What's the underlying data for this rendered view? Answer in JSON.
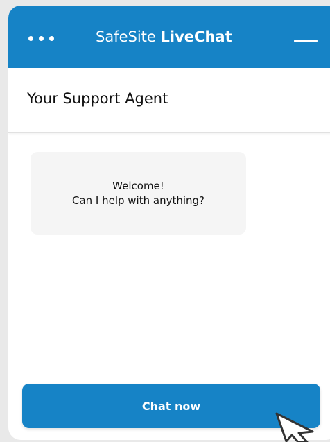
{
  "header": {
    "title_regular": "SafeSite",
    "title_bold": "LiveChat",
    "menu_icon": "more-dots-icon",
    "minimize_icon": "minimize-icon"
  },
  "agent": {
    "title": "Your Support Agent"
  },
  "conversation": {
    "messages": [
      {
        "line1": "Welcome!",
        "line2": "Can I help with anything?"
      }
    ]
  },
  "actions": {
    "chat_now": "Chat now"
  },
  "colors": {
    "brand": "#1683c6",
    "bubble": "#f5f5f5",
    "text": "#111111"
  }
}
